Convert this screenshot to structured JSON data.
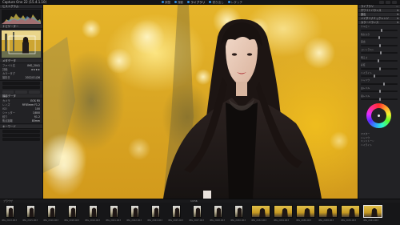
{
  "app": {
    "title": "Capture One 22 (15.4.1.10)"
  },
  "topbar": {
    "tabs": [
      {
        "label": "調整",
        "active": false
      },
      {
        "label": "撮影",
        "active": false
      },
      {
        "label": "ライブラリ",
        "active": true
      },
      {
        "label": "書き出し",
        "active": false
      },
      {
        "label": "レタッチ",
        "active": false
      }
    ]
  },
  "left_panel": {
    "histogram_label": "ヒストグラム",
    "navigator_label": "ナビゲーター",
    "metadata_label": "メタデータ",
    "rows": [
      {
        "label": "ファイル名",
        "value": "IMG_2041"
      },
      {
        "label": "評価",
        "value": "★★★★"
      },
      {
        "label": "カラータグ",
        "value": ""
      },
      {
        "label": "撮影日",
        "value": "2022/11/26"
      }
    ],
    "exif_label": "撮影データ",
    "exif_rows": [
      {
        "label": "カメラ",
        "value": "EOS R5"
      },
      {
        "label": "レンズ",
        "value": "RF85mm F1.2"
      },
      {
        "label": "ISO",
        "value": "100"
      },
      {
        "label": "シャッター",
        "value": "1/800"
      },
      {
        "label": "絞り",
        "value": "f/1.2"
      },
      {
        "label": "焦点距離",
        "value": "85mm"
      }
    ],
    "keyword_label": "キーワード"
  },
  "right_panel": {
    "header": "ライブラリ",
    "sections": [
      {
        "label": "ホワイトバランス"
      },
      {
        "label": "露出"
      },
      {
        "label": "ハイダイナミックレンジ"
      },
      {
        "label": "カラーバランス"
      }
    ],
    "sliders": [
      {
        "label": "ケルビン",
        "value": 0.55
      },
      {
        "label": "色かぶり",
        "value": 0.48
      },
      {
        "label": "露出",
        "value": 0.5
      },
      {
        "label": "コントラスト",
        "value": 0.52
      },
      {
        "label": "明るさ",
        "value": 0.46
      },
      {
        "label": "彩度",
        "value": 0.5
      },
      {
        "label": "ハイライト",
        "value": 0.35
      },
      {
        "label": "シャドウ",
        "value": 0.6
      },
      {
        "label": "白レベル",
        "value": 0.5
      },
      {
        "label": "黒レベル",
        "value": 0.5
      }
    ],
    "bottom_rows": [
      {
        "label": "マスター"
      },
      {
        "label": "シャドウ"
      },
      {
        "label": "ミッドトーン"
      },
      {
        "label": "ハイライト"
      }
    ]
  },
  "filmstrip": {
    "label": "ブラウザ",
    "counter": "1/156",
    "thumbs": [
      {
        "caption": "IMG_2013.CR3",
        "orient": "portrait"
      },
      {
        "caption": "IMG_2015.CR3",
        "orient": "portrait"
      },
      {
        "caption": "IMG_2016.CR3",
        "orient": "portrait"
      },
      {
        "caption": "IMG_2018.CR3",
        "orient": "portrait"
      },
      {
        "caption": "IMG_2019.CR3",
        "orient": "portrait"
      },
      {
        "caption": "IMG_2021.CR3",
        "orient": "portrait"
      },
      {
        "caption": "IMG_2022.CR3",
        "orient": "portrait"
      },
      {
        "caption": "IMG_2024.CR3",
        "orient": "portrait"
      },
      {
        "caption": "IMG_2025.CR3",
        "orient": "portrait"
      },
      {
        "caption": "IMG_2027.CR3",
        "orient": "portrait"
      },
      {
        "caption": "IMG_2028.CR3",
        "orient": "portrait"
      },
      {
        "caption": "IMG_2030.CR3",
        "orient": "portrait"
      },
      {
        "caption": "IMG_2032.CR3",
        "orient": "landscape"
      },
      {
        "caption": "IMG_2034.CR3",
        "orient": "landscape"
      },
      {
        "caption": "IMG_2036.CR3",
        "orient": "landscape"
      },
      {
        "caption": "IMG_2038.CR3",
        "orient": "landscape"
      },
      {
        "caption": "IMG_2039.CR3",
        "orient": "landscape"
      },
      {
        "caption": "IMG_2041.CR3",
        "orient": "landscape",
        "selected": true
      }
    ]
  },
  "colors": {
    "accent": "#2f8cdf",
    "panel": "#222225",
    "ginkgo": "#dba824"
  }
}
